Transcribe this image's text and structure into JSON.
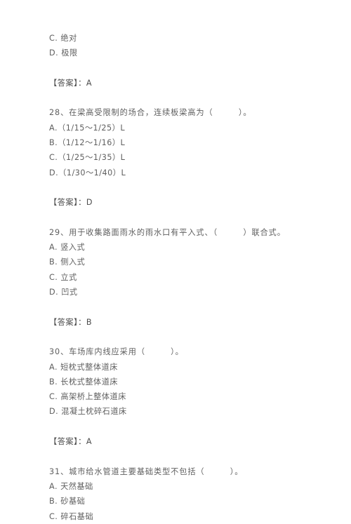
{
  "document": {
    "type": "exam-question-sheet",
    "language": "zh-CN",
    "answer_prefix": "【答案】",
    "answer_separator": "：",
    "blocks": [
      {
        "kind": "orphan-options",
        "options": [
          "C. 绝对",
          "D. 极限"
        ],
        "answer_label": "【答案】",
        "answer_value": "A",
        "answer_line": "【答案】：A"
      },
      {
        "kind": "question",
        "number": "28",
        "stem": "28、在梁高受限制的场合，连续板梁高为（　　　）。",
        "options": [
          "A.（1/15～1/25）L",
          "B.（1/12～1/16）L",
          "C.（1/25～1/35）L",
          "D.（1/30～1/40）L"
        ],
        "answer_label": "【答案】",
        "answer_value": "D",
        "answer_line": "【答案】：D"
      },
      {
        "kind": "question",
        "number": "29",
        "stem": "29、用于收集路面雨水的雨水口有平入式、（　　　）联合式。",
        "options": [
          "A. 竖入式",
          "B. 侧入式",
          "C. 立式",
          "D. 凹式"
        ],
        "answer_label": "【答案】",
        "answer_value": "B",
        "answer_line": "【答案】：B"
      },
      {
        "kind": "question",
        "number": "30",
        "stem": "30、车场库内线应采用（　　　）。",
        "options": [
          "A. 短枕式整体道床",
          "B. 长枕式整体道床",
          "C. 高架桥上整体道床",
          "D. 混凝土枕碎石道床"
        ],
        "answer_label": "【答案】",
        "answer_value": "A",
        "answer_line": "【答案】：A"
      },
      {
        "kind": "question-truncated",
        "number": "31",
        "stem": "31、城市给水管道主要基础类型不包括（　　　）。",
        "options": [
          "A. 天然基础",
          "B. 砂基础",
          "C. 碎石基础"
        ]
      }
    ]
  },
  "colors": {
    "page_background": "#ffffff",
    "body_text": "#5f5f5f",
    "answer_text": "#4d4d4d",
    "answer_bracket": "#3d3d3d"
  }
}
